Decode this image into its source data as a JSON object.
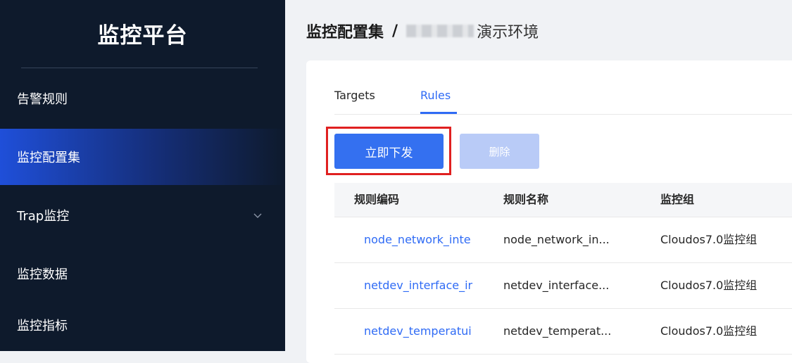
{
  "sidebar": {
    "brand": "监控平台",
    "items": [
      {
        "label": "告警规则"
      },
      {
        "label": "监控配置集"
      },
      {
        "label": "Trap监控"
      },
      {
        "label": "监控数据"
      },
      {
        "label": "监控指标"
      }
    ]
  },
  "breadcrumb": {
    "parent": "监控配置集",
    "separator": "/",
    "current": "演示环境"
  },
  "tabs": [
    {
      "label": "Targets"
    },
    {
      "label": "Rules"
    }
  ],
  "actions": {
    "deploy_label": "立即下发",
    "delete_label": "删除"
  },
  "table": {
    "headers": [
      "规则编码",
      "规则名称",
      "监控组"
    ],
    "rows": [
      {
        "code": "node_network_inte",
        "name": "node_network_in...",
        "group": "Cloudos7.0监控组"
      },
      {
        "code": "netdev_interface_ir",
        "name": "netdev_interface...",
        "group": "Cloudos7.0监控组"
      },
      {
        "code": "netdev_temperatui",
        "name": "netdev_temperat...",
        "group": "Cloudos7.0监控组"
      }
    ]
  },
  "colors": {
    "sidebar_bg": "#0e1a2c",
    "accent": "#3470f0",
    "highlight": "#e02020"
  }
}
